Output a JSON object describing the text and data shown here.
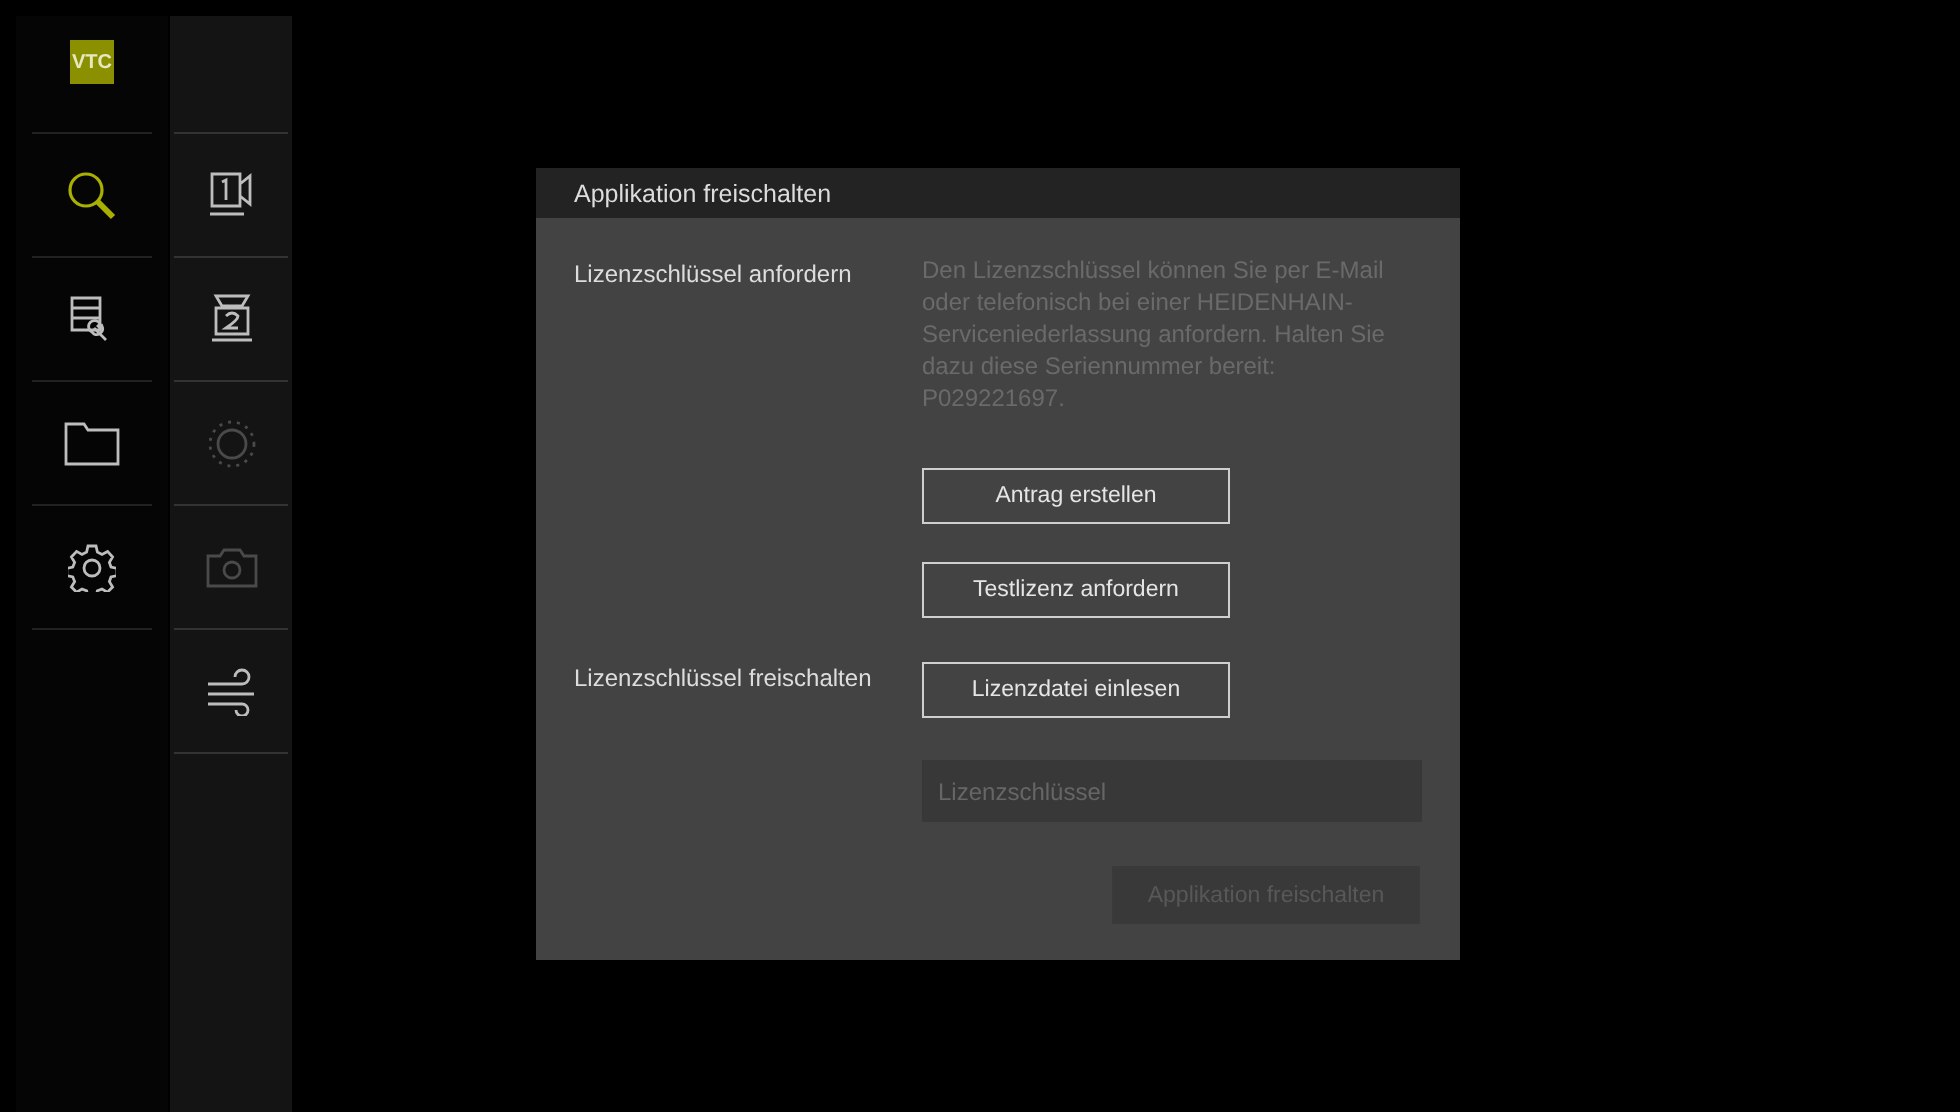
{
  "sidebar": {
    "logo": "VTC",
    "items": [
      {
        "kind": "search",
        "selected": true
      },
      {
        "kind": "setup",
        "selected": false
      },
      {
        "kind": "folder",
        "selected": false
      },
      {
        "kind": "settings",
        "selected": false
      }
    ]
  },
  "toolbar": {
    "items": [
      {
        "kind": "camera-one",
        "disabled": false
      },
      {
        "kind": "camera-two",
        "disabled": false
      },
      {
        "kind": "light",
        "disabled": true
      },
      {
        "kind": "photo",
        "disabled": true
      },
      {
        "kind": "air",
        "disabled": false
      }
    ]
  },
  "dialog": {
    "title": "Applikation freischalten",
    "sections": [
      {
        "label": "Lizenzschlüssel anfordern",
        "description": "Den Lizenzschlüssel können Sie per E-Mail oder telefonisch bei einer HEIDENHAIN-Serviceniederlassung anfordern. Halten Sie dazu diese Seriennummer bereit: P029221697.",
        "buttons": [
          {
            "label": "Antrag erstellen",
            "disabled": false
          },
          {
            "label": "Testlizenz anfordern",
            "disabled": false
          }
        ]
      },
      {
        "label": "Lizenzschlüssel freischalten",
        "buttons": [
          {
            "label": "Lizenzdatei einlesen",
            "disabled": false
          }
        ],
        "field": {
          "placeholder": "Lizenzschlüssel"
        }
      }
    ],
    "footer_button": {
      "label": "Applikation freischalten",
      "disabled": true
    }
  }
}
